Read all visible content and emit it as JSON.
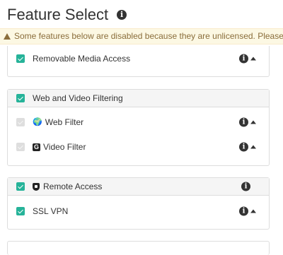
{
  "header": {
    "title": "Feature Select",
    "info_icon": "info-circle-icon"
  },
  "warning": {
    "text": "Some features below are disabled because they are unlicensed. Please upgrade your license to enable them.",
    "icon": "warning-triangle-icon"
  },
  "sections": [
    {
      "rows": [
        {
          "label": "Removable Media Access",
          "checked": true,
          "disabled": false
        }
      ]
    },
    {
      "heading": "Web and Video Filtering",
      "rows": [
        {
          "label": "Web Filter",
          "icon": "globe-icon",
          "checked": true,
          "disabled": true
        },
        {
          "label": "Video Filter",
          "icon": "video-filter-icon",
          "checked": true,
          "disabled": true
        }
      ]
    },
    {
      "heading": "Remote Access",
      "heading_icon": "shield-icon",
      "rows": [
        {
          "label": "SSL VPN",
          "checked": true,
          "disabled": false
        }
      ]
    }
  ],
  "colors": {
    "checkbox": "#26b399",
    "checkbox_disabled": "#dedede",
    "warning_bg": "#fcf8e3",
    "warning_text": "#8a6d3b"
  }
}
